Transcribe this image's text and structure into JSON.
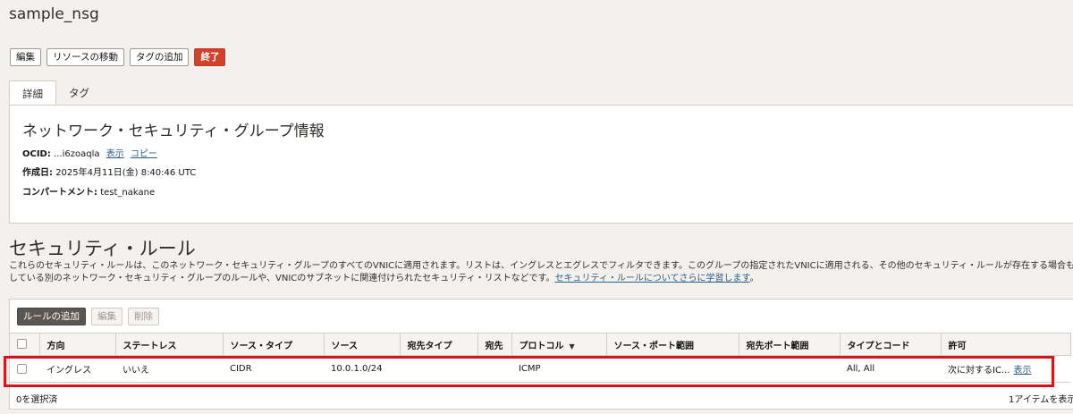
{
  "title": "sample_nsg",
  "actions": {
    "edit": "編集",
    "move_resource": "リソースの移動",
    "add_tags": "タグの追加",
    "terminate": "終了"
  },
  "tabs": [
    {
      "label": "詳細",
      "active": true
    },
    {
      "label": "タグ",
      "active": false
    }
  ],
  "details": {
    "heading": "ネットワーク・セキュリティ・グループ情報",
    "ocid_label": "OCID:",
    "ocid_value": "...i6zoaqla",
    "show_link": "表示",
    "copy_link": "コピー",
    "created_label": "作成日:",
    "created_value": "2025年4月11日(金) 8:40:46 UTC",
    "compartment_label": "コンパートメント:",
    "compartment_value": "test_nakane"
  },
  "security_rules": {
    "title": "セキュリティ・ルール",
    "description_line1": "これらのセキュリティ・ルールは、このネットワーク・セキュリティ・グループのすべてのVNICに適用されます。リストは、イングレスとエグレスでフィルタできます。このグループの指定されたVNICに適用される、その他のセキュリティ・ルールが存在する場合もあり",
    "description_line2": "している別のネットワーク・セキュリティ・グループのルールや、VNICのサブネットに関連付けられたセキュリティ・リストなどです。",
    "learn_more": "セキュリティ・ルールについてさらに学習します",
    "period": "。",
    "add_rule": "ルールの追加",
    "edit": "編集",
    "delete": "削除",
    "columns": [
      "方向",
      "ステートレス",
      "ソース・タイプ",
      "ソース",
      "宛先タイプ",
      "宛先",
      "プロトコル",
      "ソース・ポート範囲",
      "宛先ポート範囲",
      "タイプとコード",
      "許可"
    ],
    "rows": [
      {
        "direction": "イングレス",
        "stateless": "いいえ",
        "source_type": "CIDR",
        "source": "10.0.1.0/24",
        "dest_type": "",
        "dest": "",
        "protocol": "ICMP",
        "source_port": "",
        "dest_port": "",
        "type_code": "All, All",
        "allows": "次に対するIC...",
        "allows_link": "表示"
      }
    ],
    "selected_count": "0を選択済",
    "items_shown": "1アイテムを表示"
  },
  "colors": {
    "danger": "#d3412b",
    "highlight": "#d4151b",
    "link": "#2b5d87"
  }
}
